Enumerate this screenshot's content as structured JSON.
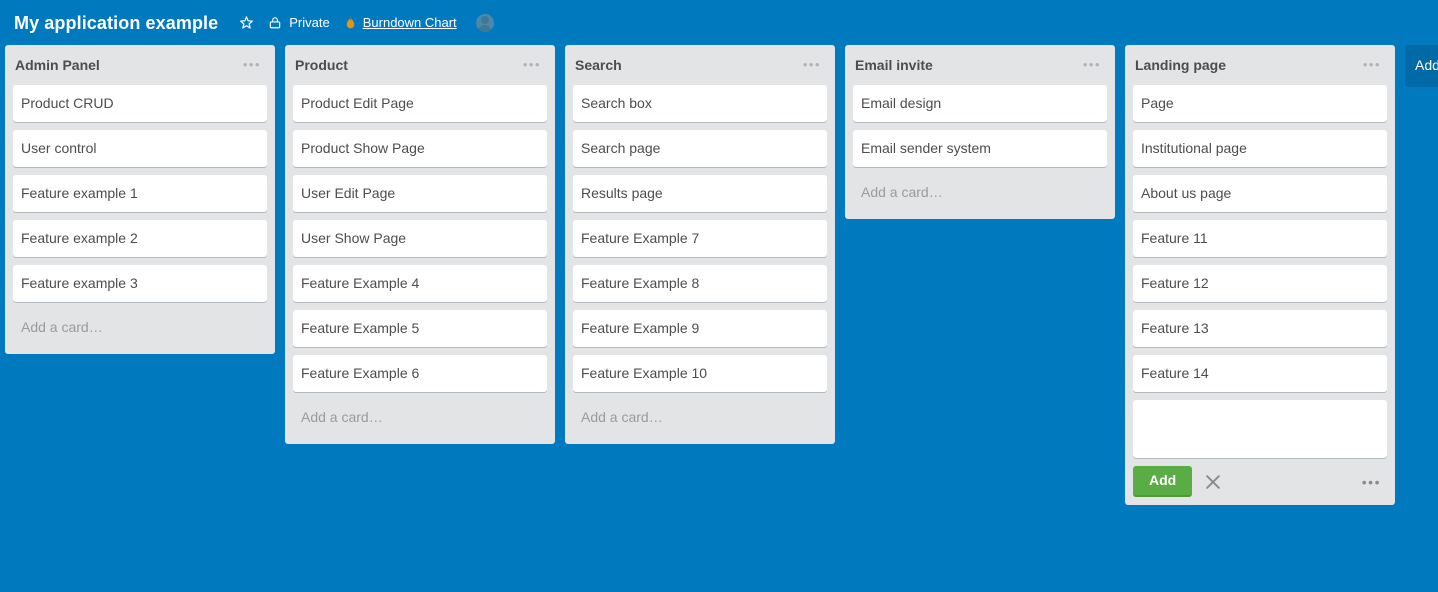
{
  "header": {
    "board_title": "My application example",
    "star_icon": "star-icon",
    "visibility_icon": "lock-icon",
    "visibility_label": "Private",
    "powerup_icon": "flame-icon",
    "powerup_link_label": "Burndown Chart",
    "avatar_icon": "user-avatar-icon"
  },
  "board": {
    "background_color": "#0079bf",
    "list_background_color": "#e2e4e6",
    "card_background_color": "#ffffff",
    "add_button_color": "#5aac44",
    "list_menu_glyph": "•••",
    "add_card_placeholder": "Add a card…",
    "add_list_label": "Add another list…",
    "lists": [
      {
        "title": "Admin Panel",
        "cards": [
          "Product CRUD",
          "User control",
          "Feature example 1",
          "Feature example 2",
          "Feature example 3"
        ],
        "composer_open": false
      },
      {
        "title": "Product",
        "cards": [
          "Product Edit Page",
          "Product Show Page",
          "User Edit Page",
          "User Show Page",
          "Feature Example 4",
          "Feature Example 5",
          "Feature Example 6"
        ],
        "composer_open": false
      },
      {
        "title": "Search",
        "cards": [
          "Search box",
          "Search page",
          "Results page",
          "Feature Example 7",
          "Feature Example 8",
          "Feature Example 9",
          "Feature Example 10"
        ],
        "composer_open": false
      },
      {
        "title": "Email invite",
        "cards": [
          "Email design",
          "Email sender system"
        ],
        "composer_open": false
      },
      {
        "title": "Landing page",
        "cards": [
          "Page",
          "Institutional page",
          "About us page",
          "Feature 11",
          "Feature 12",
          "Feature 13",
          "Feature 14"
        ],
        "composer_open": true,
        "composer": {
          "value": "",
          "placeholder": "",
          "add_label": "Add",
          "close_icon": "close-icon",
          "options_icon": "ellipsis-icon"
        }
      }
    ]
  }
}
